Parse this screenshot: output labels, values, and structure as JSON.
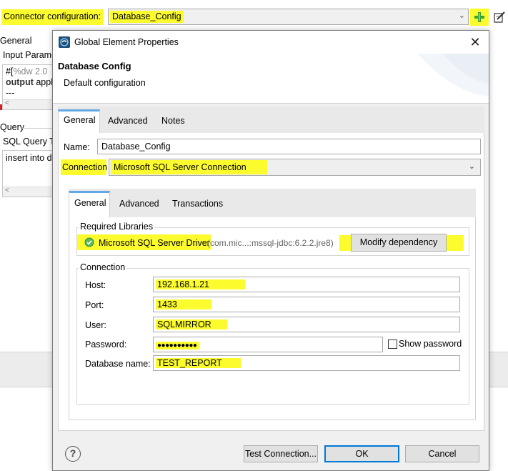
{
  "background": {
    "connector_label": "Connector configuration:",
    "connector_value": "Database_Config",
    "general_tab": "General",
    "input_params_label": "Input Parame",
    "dw_line1_prefix": "#[",
    "dw_line1_rest": "%dw 2.0",
    "dw_line2_keyword": "output",
    "dw_line2_rest": " appl",
    "dw_line3": "---",
    "query_section": "Query",
    "sql_query_label": "SQL Query Te",
    "sql_query_text": "insert into dl"
  },
  "dialog": {
    "window_title": "Global Element Properties",
    "header_title": "Database Config",
    "header_subtitle": "Default configuration",
    "tabs": [
      {
        "label": "General",
        "active": true
      },
      {
        "label": "Advanced",
        "active": false
      },
      {
        "label": "Notes",
        "active": false
      }
    ],
    "name_label": "Name:",
    "name_value": "Database_Config",
    "connection_label": "Connection",
    "connection_value": "Microsoft SQL Server Connection",
    "inner_tabs": [
      {
        "label": "General",
        "active": true
      },
      {
        "label": "Advanced",
        "active": false
      },
      {
        "label": "Transactions",
        "active": false
      }
    ],
    "required_libraries_title": "Required Libraries",
    "driver_name": "Microsoft SQL Server Driver",
    "driver_artifact": "(com.mic...:mssql-jdbc:6.2.2.jre8)",
    "modify_dependency_label": "Modify dependency",
    "connection_group_title": "Connection",
    "host_label": "Host:",
    "host_value": "192.168.1.21",
    "port_label": "Port:",
    "port_value": "1433",
    "user_label": "User:",
    "user_value": "SQLMIRROR",
    "password_label": "Password:",
    "password_value": "●●●●●●●●●●",
    "show_password_label": "Show password",
    "show_password_checked": false,
    "database_label": "Database name:",
    "database_value": "TEST_REPORT",
    "test_connection_label": "Test Connection...",
    "ok_label": "OK",
    "cancel_label": "Cancel",
    "help_symbol": "?"
  },
  "colors": {
    "highlight": "#fbfb2e",
    "tab_accent": "#62a8e4",
    "success": "#5cb85c",
    "plus_icon": "#3aa335"
  }
}
